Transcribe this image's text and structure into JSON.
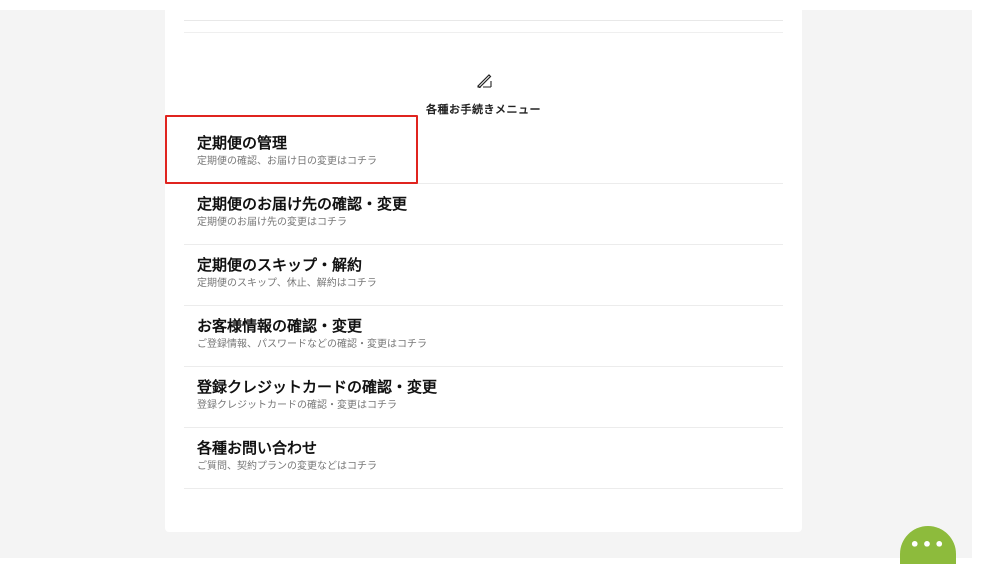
{
  "menu": {
    "icon": "pencil-writing-icon",
    "heading": "各種お手続きメニュー",
    "items": [
      {
        "title": "定期便の管理",
        "sub": "定期便の確認、お届け日の変更はコチラ"
      },
      {
        "title": "定期便のお届け先の確認・変更",
        "sub": "定期便のお届け先の変更はコチラ"
      },
      {
        "title": "定期便のスキップ・解約",
        "sub": "定期便のスキップ、休止、解約はコチラ"
      },
      {
        "title": "お客様情報の確認・変更",
        "sub": "ご登録情報、パスワードなどの確認・変更はコチラ"
      },
      {
        "title": "登録クレジットカードの確認・変更",
        "sub": "登録クレジットカードの確認・変更はコチラ"
      },
      {
        "title": "各種お問い合わせ",
        "sub": "ご質問、契約プランの変更などはコチラ"
      }
    ]
  },
  "chat": {
    "label": "•••",
    "icon": "chat-more-icon",
    "color": "#8dbb3c"
  },
  "highlight": {
    "color": "#e0241f",
    "target": "定期便の管理"
  }
}
